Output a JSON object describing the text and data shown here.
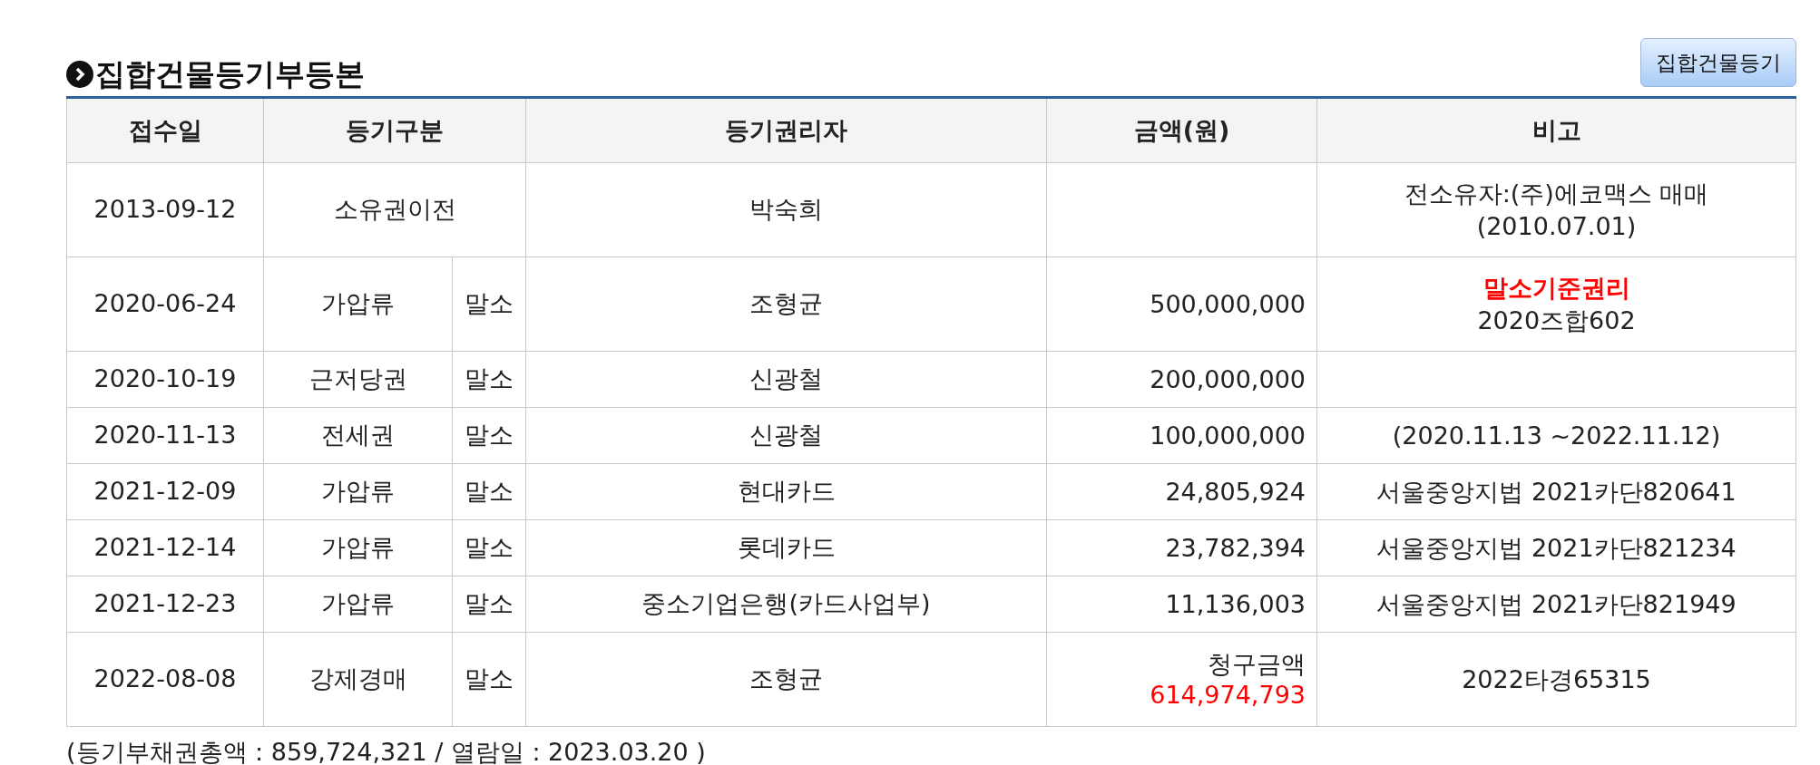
{
  "title": "집합건물등기부등본",
  "button": "집합건물등기",
  "table": {
    "columns": [
      "접수일",
      "등기구분",
      "등기권리자",
      "금액(원)",
      "비고"
    ],
    "rows": [
      {
        "date": "2013-09-12",
        "type": "소유권이전",
        "holder": "박숙희",
        "remarks": [
          {
            "text": "전소유자:(주)에코맥스 매매",
            "highlighted": false
          },
          {
            "text": "(2010.07.01)",
            "highlighted": false
          }
        ]
      },
      {
        "date": "2020-06-24",
        "type": "가압류",
        "cancel": "말소",
        "holder": "조형균",
        "amount": "500,000,000",
        "amount_highlighted": false,
        "remarks": [
          {
            "text": "말소기준권리",
            "highlighted": true
          },
          {
            "text": "2020즈합602",
            "highlighted": false
          }
        ]
      },
      {
        "date": "2020-10-19",
        "type": "근저당권",
        "cancel": "말소",
        "holder": "신광철",
        "amount": "200,000,000",
        "amount_highlighted": false
      },
      {
        "date": "2020-11-13",
        "type": "전세권",
        "cancel": "말소",
        "holder": "신광철",
        "amount": "100,000,000",
        "amount_highlighted": false,
        "remarks": [
          {
            "text": "(2020.11.13 ~2022.11.12)",
            "highlighted": false
          }
        ]
      },
      {
        "date": "2021-12-09",
        "type": "가압류",
        "cancel": "말소",
        "holder": "현대카드",
        "amount": "24,805,924",
        "amount_highlighted": false,
        "remarks": [
          {
            "text": "서울중앙지법 2021카단820641",
            "highlighted": false
          }
        ]
      },
      {
        "date": "2021-12-14",
        "type": "가압류",
        "cancel": "말소",
        "holder": "롯데카드",
        "amount": "23,782,394",
        "amount_highlighted": false,
        "remarks": [
          {
            "text": "서울중앙지법 2021카단821234",
            "highlighted": false
          }
        ]
      },
      {
        "date": "2021-12-23",
        "type": "가압류",
        "cancel": "말소",
        "holder": "중소기업은행(카드사업부)",
        "amount": "11,136,003",
        "amount_highlighted": false,
        "remarks": [
          {
            "text": "서울중앙지법 2021카단821949",
            "highlighted": false
          }
        ]
      },
      {
        "date": "2022-08-08",
        "type": "강제경매",
        "cancel": "말소",
        "holder": "조형균",
        "amount_label": "청구금액",
        "amount": "614,974,793",
        "amount_highlighted": true,
        "remarks": [
          {
            "text": "2022타경65315",
            "highlighted": false
          }
        ]
      }
    ]
  },
  "footer": "(등기부채권총액 : 859,724,321 / 열람일 : 2023.03.20 )"
}
